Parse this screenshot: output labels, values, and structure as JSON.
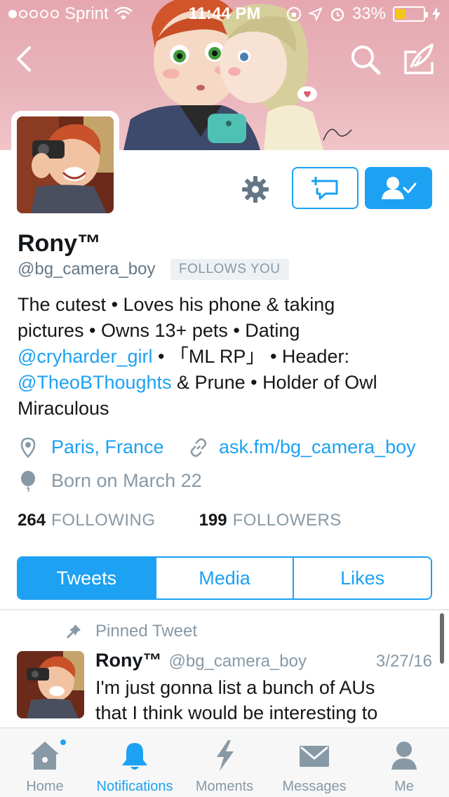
{
  "status_bar": {
    "carrier": "Sprint",
    "time": "11:44 PM",
    "battery": "33%",
    "battery_level": 0.33
  },
  "profile": {
    "name": "Rony™",
    "handle": "@bg_camera_boy",
    "follows_you": "FOLLOWS YOU",
    "bio": {
      "line1": "The cutest • Loves his phone & taking",
      "line2": "pictures • Owns 13+ pets • Dating",
      "line3_link": "@cryharder_girl",
      "line3_rest": " • 「ML RP」 • Header:",
      "line4_link": "@TheoBThoughts",
      "line4_rest": " & Prune • Holder of Owl",
      "line5": "Miraculous"
    },
    "location": "Paris, France",
    "website": "ask.fm/bg_camera_boy",
    "birthday": "Born on March 22",
    "following_count": "264",
    "following_label": "FOLLOWING",
    "followers_count": "199",
    "followers_label": "FOLLOWERS"
  },
  "tabs": [
    {
      "label": "Tweets",
      "active": true
    },
    {
      "label": "Media",
      "active": false
    },
    {
      "label": "Likes",
      "active": false
    }
  ],
  "pinned_tweet": {
    "pinned_label": "Pinned Tweet",
    "name": "Rony™",
    "handle": "@bg_camera_boy",
    "date": "3/27/16",
    "text_line1": "I'm just gonna list a bunch of AUs",
    "text_line2": "that I think would be interesting to"
  },
  "tab_bar": [
    {
      "label": "Home",
      "icon": "home-icon"
    },
    {
      "label": "Notifications",
      "icon": "bell-icon",
      "active": true
    },
    {
      "label": "Moments",
      "icon": "lightning-icon"
    },
    {
      "label": "Messages",
      "icon": "envelope-icon"
    },
    {
      "label": "Me",
      "icon": "person-icon"
    }
  ],
  "colors": {
    "accent": "#1da1f2",
    "header_bg": "#e6a7b0",
    "muted": "#8899a6"
  }
}
